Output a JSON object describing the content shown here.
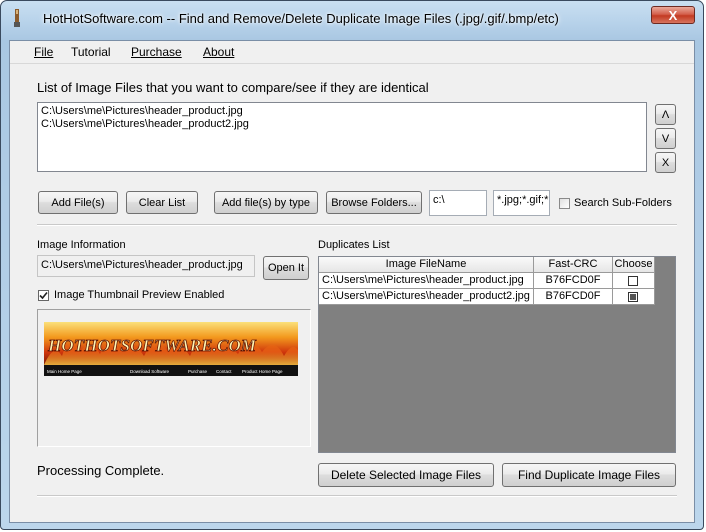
{
  "window": {
    "title": "HotHotSoftware.com -- Find and Remove/Delete Duplicate Image Files (.jpg/.gif/.bmp/etc)",
    "close_glyph": "X"
  },
  "menu": {
    "items": [
      "File",
      "Tutorial",
      "Purchase",
      "About"
    ]
  },
  "file_list": {
    "label": "List of Image Files that you want to compare/see if they are identical",
    "items": [
      "C:\\Users\\me\\Pictures\\header_product.jpg",
      "C:\\Users\\me\\Pictures\\header_product2.jpg"
    ],
    "move_up": "Λ",
    "move_down": "V",
    "remove": "X"
  },
  "toolbar": {
    "add_files": "Add File(s)",
    "clear_list": "Clear List",
    "add_by_type": "Add file(s) by type",
    "browse_folders": "Browse Folders...",
    "path_value": "c:\\",
    "type_filter": "*.jpg;*.gif;*.",
    "search_sub_folders": "Search Sub-Folders",
    "search_sub_folders_checked": false
  },
  "image_info": {
    "label": "Image Information",
    "path": "C:\\Users\\me\\Pictures\\header_product.jpg",
    "open_button": "Open It",
    "thumbnail_preview_label": "Image Thumbnail Preview Enabled",
    "thumbnail_preview_checked": true
  },
  "thumbnail": {
    "logo_text": "HOTHOTSOFTWARE.COM",
    "nav_left": "Main Home Page",
    "nav_links": [
      "Download Software",
      "Purchase",
      "Contact",
      "Product Home Page"
    ]
  },
  "duplicates": {
    "label": "Duplicates List",
    "columns": [
      "Image FileName",
      "Fast-CRC",
      "Choose"
    ],
    "rows": [
      {
        "file": "C:\\Users\\me\\Pictures\\header_product.jpg",
        "crc": "B76FCD0F",
        "chosen": false
      },
      {
        "file": "C:\\Users\\me\\Pictures\\header_product2.jpg",
        "crc": "B76FCD0F",
        "chosen": true
      }
    ]
  },
  "status": {
    "text": "Processing Complete."
  },
  "actions": {
    "delete_selected": "Delete Selected Image Files",
    "find_duplicates": "Find Duplicate Image Files"
  }
}
